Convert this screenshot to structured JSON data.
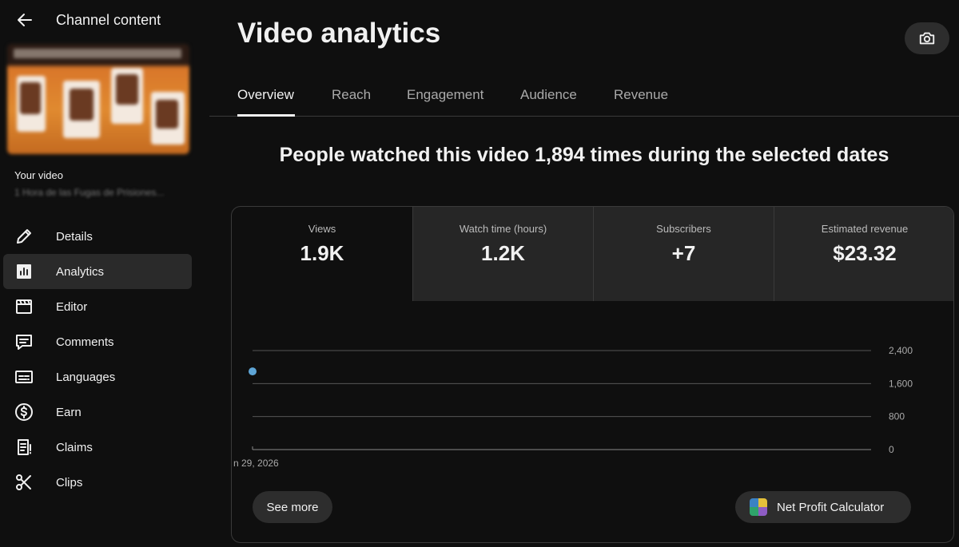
{
  "sidebar": {
    "title": "Channel content",
    "your_video_label": "Your video",
    "video_name": "1 Hora de las Fugas de Prisiones...",
    "items": [
      {
        "label": "Details",
        "icon": "pencil-icon"
      },
      {
        "label": "Analytics",
        "icon": "analytics-icon",
        "active": true
      },
      {
        "label": "Editor",
        "icon": "clapperboard-icon"
      },
      {
        "label": "Comments",
        "icon": "comment-icon"
      },
      {
        "label": "Languages",
        "icon": "subtitles-icon"
      },
      {
        "label": "Earn",
        "icon": "dollar-circle-icon"
      },
      {
        "label": "Claims",
        "icon": "claims-icon"
      },
      {
        "label": "Clips",
        "icon": "scissors-icon"
      }
    ]
  },
  "main": {
    "title": "Video analytics",
    "tabs": [
      {
        "label": "Overview",
        "active": true
      },
      {
        "label": "Reach"
      },
      {
        "label": "Engagement"
      },
      {
        "label": "Audience"
      },
      {
        "label": "Revenue"
      }
    ],
    "headline": "People watched this video 1,894 times during the selected dates",
    "metrics": [
      {
        "label": "Views",
        "value": "1.9K"
      },
      {
        "label": "Watch time (hours)",
        "value": "1.2K"
      },
      {
        "label": "Subscribers",
        "value": "+7"
      },
      {
        "label": "Estimated revenue",
        "value": "$23.32"
      }
    ],
    "see_more_label": "See more",
    "net_profit_label": "Net Profit Calculator"
  },
  "chart_data": {
    "type": "line",
    "x": [
      "n 29, 2026"
    ],
    "series": [
      {
        "values": [
          1894
        ]
      }
    ],
    "ylim": [
      0,
      2400
    ],
    "yticks": [
      "2,400",
      "1,600",
      "800",
      "0"
    ],
    "ytick_values": [
      2400,
      1600,
      800,
      0
    ],
    "grid": true,
    "colors": {
      "point": "#5ea5d6",
      "grid": "#555555"
    }
  },
  "colors": {
    "background": "#0f0f0f",
    "active_nav": "#2a2a2a",
    "metric_inactive": "#262626"
  }
}
